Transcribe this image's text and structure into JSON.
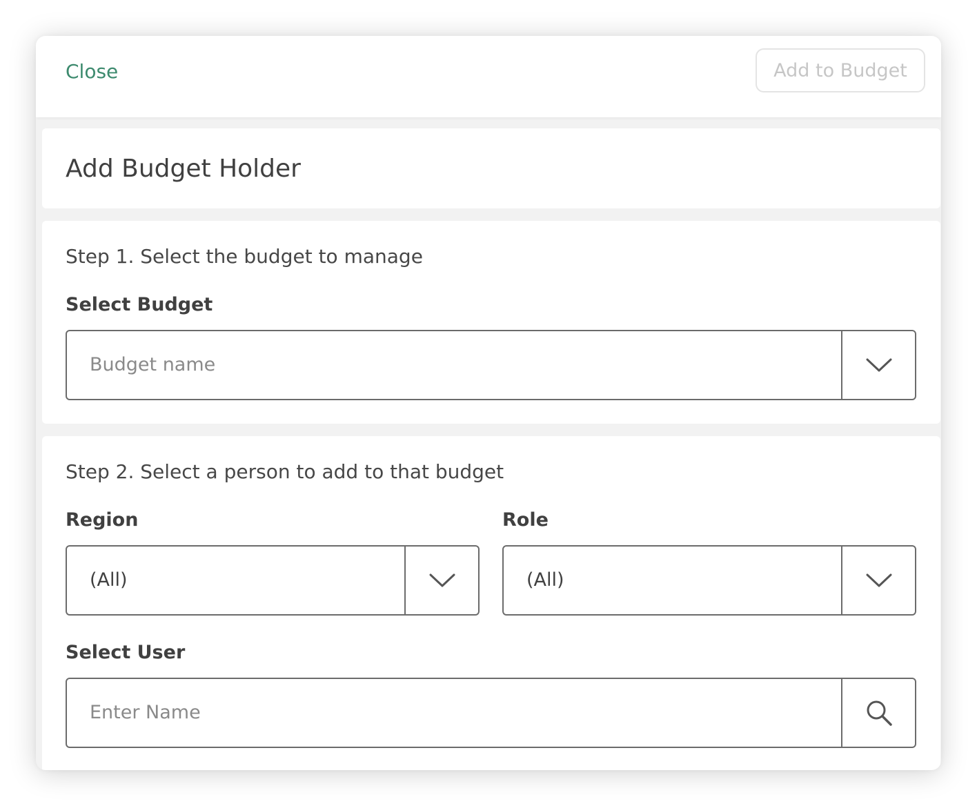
{
  "header": {
    "close_label": "Close",
    "add_label": "Add to Budget"
  },
  "title": "Add Budget Holder",
  "step1": {
    "text": "Step 1. Select the budget to manage",
    "label": "Select Budget",
    "placeholder": "Budget name",
    "icon": "chevron-down-icon"
  },
  "step2": {
    "text": "Step 2. Select a person to add to that budget",
    "region": {
      "label": "Region",
      "value": "(All)",
      "icon": "chevron-down-icon"
    },
    "role": {
      "label": "Role",
      "value": "(All)",
      "icon": "chevron-down-icon"
    },
    "user": {
      "label": "Select User",
      "placeholder": "Enter Name",
      "icon": "search-icon"
    }
  },
  "colors": {
    "accent": "#3d8a6e",
    "border": "#6b6b6b",
    "disabled": "#c6c6c6"
  }
}
